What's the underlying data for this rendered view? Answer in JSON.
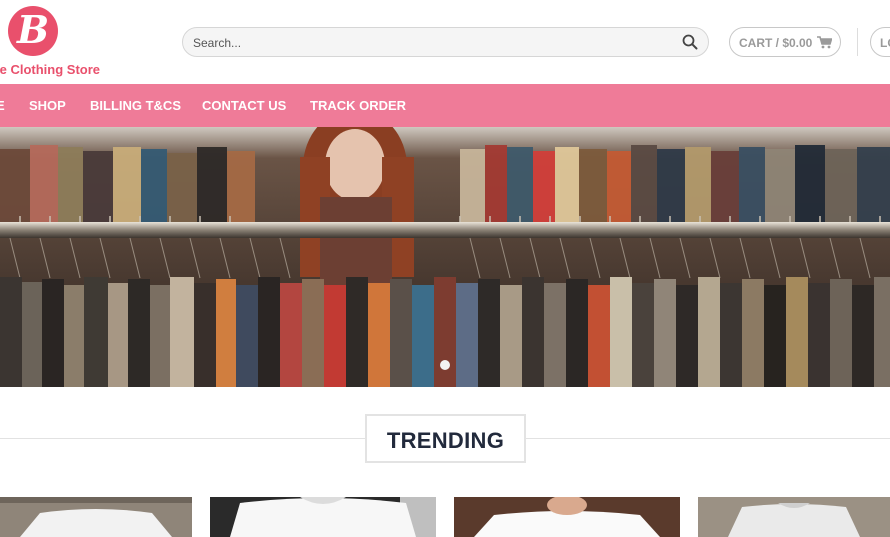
{
  "header": {
    "logo_letter": "B",
    "logo_text": "le Clothing Store",
    "search_placeholder": "Search...",
    "cart_label": "CART / $0.00",
    "login_label": "LO"
  },
  "nav": {
    "items": [
      {
        "label": "E"
      },
      {
        "label": "SHOP"
      },
      {
        "label": "BILLING T&CS"
      },
      {
        "label": "CONTACT US"
      },
      {
        "label": "TRACK ORDER"
      }
    ]
  },
  "section": {
    "title": "TRENDING"
  },
  "colors": {
    "brand_pink": "#e9506c",
    "nav_pink": "#ef7b98",
    "heading": "#222a3c"
  }
}
